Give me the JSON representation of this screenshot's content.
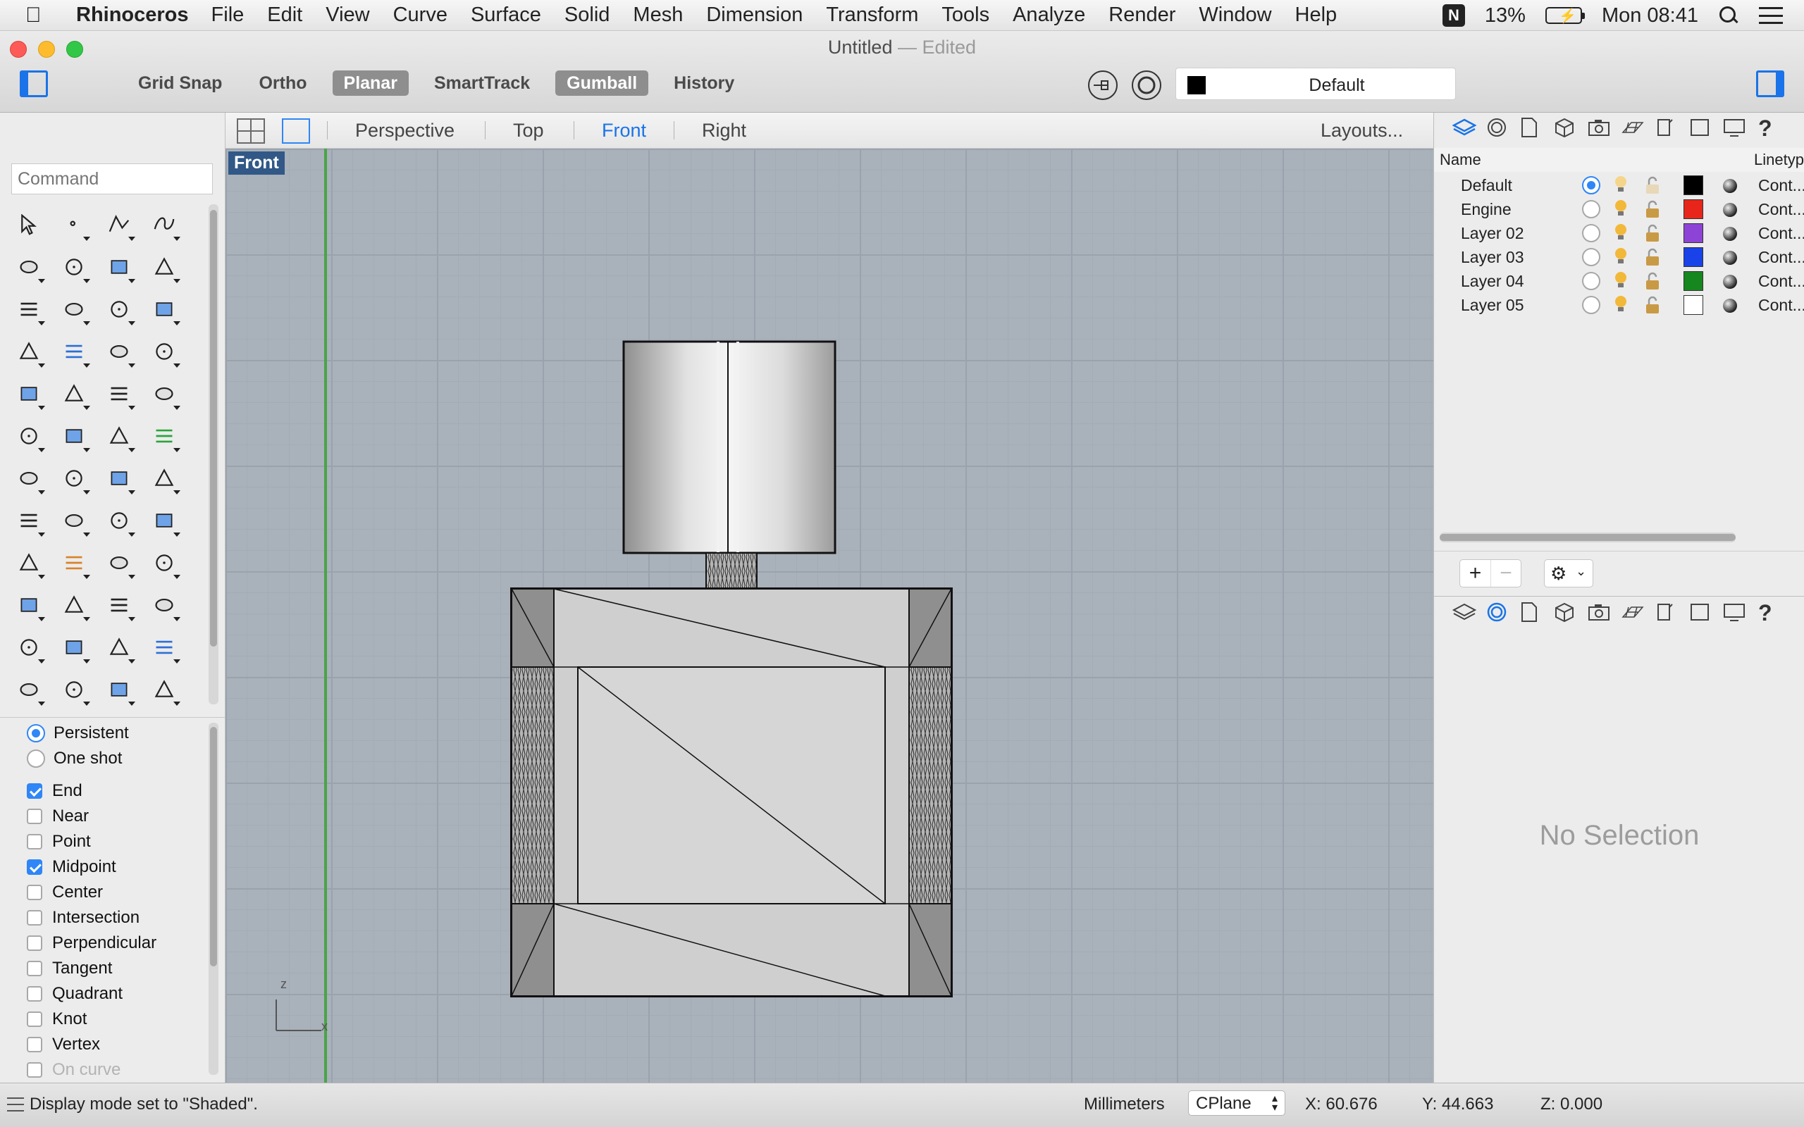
{
  "menubar": {
    "app_name": "Rhinoceros",
    "items": [
      "File",
      "Edit",
      "View",
      "Curve",
      "Surface",
      "Solid",
      "Mesh",
      "Dimension",
      "Transform",
      "Tools",
      "Analyze",
      "Render",
      "Window",
      "Help"
    ],
    "n_badge": "N",
    "battery": "13%",
    "clock": "Mon 08:41"
  },
  "window": {
    "title": "Untitled",
    "separator": "—",
    "edited": "Edited"
  },
  "toolbar": {
    "modes": [
      {
        "label": "Grid Snap",
        "active": false
      },
      {
        "label": "Ortho",
        "active": false
      },
      {
        "label": "Planar",
        "active": true
      },
      {
        "label": "SmartTrack",
        "active": false
      },
      {
        "label": "Gumball",
        "active": true
      },
      {
        "label": "History",
        "active": false
      }
    ],
    "layer_select": "Default"
  },
  "viewport": {
    "tabs": [
      "Perspective",
      "Top",
      "Front",
      "Right"
    ],
    "active_tab": "Front",
    "layouts_label": "Layouts...",
    "label": "Front",
    "axis_z": "z",
    "axis_x": "x"
  },
  "command": {
    "placeholder": "Command"
  },
  "tools": [
    "select-arrow",
    "point",
    "polyline",
    "curve",
    "circle",
    "ellipse",
    "arc",
    "rectangle",
    "polygon",
    "fillet-curve",
    "surface-from-points",
    "patch-surface",
    "box-solid",
    "sphere-solid",
    "cylinder-solid",
    "mesh-plane",
    "explode",
    "extrude",
    "split",
    "trim",
    "boolean",
    "join",
    "curve-from-object",
    "rebuild",
    "text",
    "scale",
    "array",
    "align",
    "block",
    "dimension",
    "grid-array",
    "move",
    "properties",
    "check-mark",
    "material",
    "render",
    "zoom",
    "zoom-window",
    "zoom-extents",
    "zoom-selected",
    "rotate-view",
    "car",
    "grid-snap",
    "layout",
    "light",
    "lock",
    "layer-color",
    "color-wheel"
  ],
  "osnap": {
    "modes": [
      {
        "label": "Persistent",
        "on": true
      },
      {
        "label": "One shot",
        "on": false
      }
    ],
    "snaps": [
      {
        "label": "End",
        "on": true
      },
      {
        "label": "Near",
        "on": false
      },
      {
        "label": "Point",
        "on": false
      },
      {
        "label": "Midpoint",
        "on": true
      },
      {
        "label": "Center",
        "on": false
      },
      {
        "label": "Intersection",
        "on": false
      },
      {
        "label": "Perpendicular",
        "on": false
      },
      {
        "label": "Tangent",
        "on": false
      },
      {
        "label": "Quadrant",
        "on": false
      },
      {
        "label": "Knot",
        "on": false
      },
      {
        "label": "Vertex",
        "on": false
      },
      {
        "label": "On curve",
        "on": false
      }
    ]
  },
  "layers": {
    "header_name": "Name",
    "header_linetype": "Linetyp",
    "rows": [
      {
        "name": "Default",
        "current": true,
        "color": "#000000",
        "linetype": "Cont..."
      },
      {
        "name": "Engine",
        "current": false,
        "color": "#e8251b",
        "linetype": "Cont..."
      },
      {
        "name": "Layer 02",
        "current": false,
        "color": "#8d44d6",
        "linetype": "Cont..."
      },
      {
        "name": "Layer 03",
        "current": false,
        "color": "#1942e8",
        "linetype": "Cont..."
      },
      {
        "name": "Layer 04",
        "current": false,
        "color": "#16871f",
        "linetype": "Cont..."
      },
      {
        "name": "Layer 05",
        "current": false,
        "color": "#ffffff",
        "linetype": "Cont..."
      }
    ],
    "add": "+",
    "remove": "−"
  },
  "properties": {
    "empty": "No Selection"
  },
  "status": {
    "message": "Display mode set to \"Shaded\".",
    "units": "Millimeters",
    "cplane": "CPlane",
    "x": "X: 60.676",
    "y": "Y: 44.663",
    "z": "Z: 0.000"
  },
  "colors": {
    "accent": "#1a73e8",
    "viewport_bg": "#a9b1ba",
    "z_axis": "#49a447",
    "viewport_label_bg": "#315886"
  }
}
